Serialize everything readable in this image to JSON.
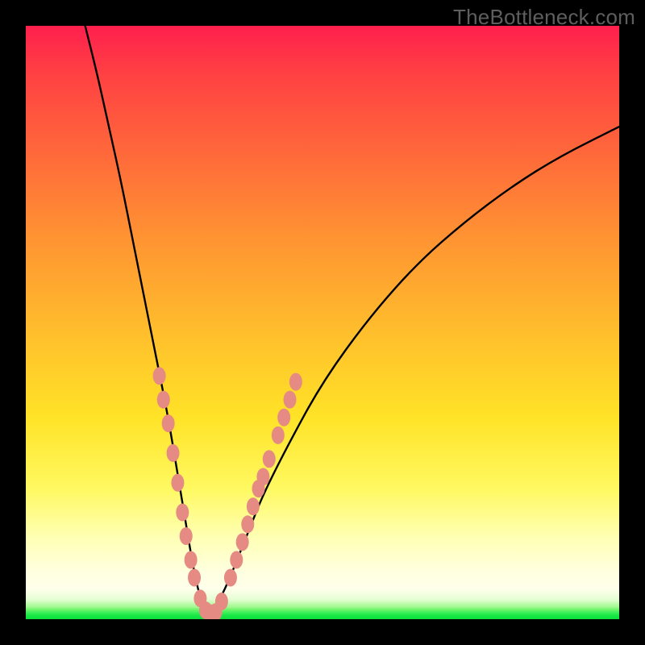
{
  "watermark": "TheBottleneck.com",
  "colors": {
    "background_outer": "#000000",
    "gradient_top": "#ff1f4e",
    "gradient_mid": "#ffe327",
    "gradient_low": "#ffffe0",
    "green_strip": "#15e845",
    "curve_stroke": "#000000",
    "dot_fill": "#e68a84"
  },
  "chart_data": {
    "type": "line",
    "title": "",
    "xlabel": "",
    "ylabel": "",
    "x_range": [
      0,
      100
    ],
    "y_range": [
      0,
      100
    ],
    "description": "V-shaped bottleneck curve: steep descending left branch, minimum near x≈30, rising right branch with decreasing slope. Curve overlaid on vertical red→yellow→green heat gradient. Salmon dots highlight the lower portion of both branches near the trough.",
    "series": [
      {
        "name": "bottleneck-curve-left",
        "x": [
          10,
          12,
          14,
          16,
          18,
          20,
          22,
          24,
          26,
          27,
          28,
          29,
          30,
          31
        ],
        "y": [
          100,
          92,
          83,
          74,
          64,
          54,
          44,
          34,
          22,
          16,
          10,
          5,
          2,
          0.5
        ]
      },
      {
        "name": "bottleneck-curve-right",
        "x": [
          31,
          32,
          34,
          36,
          38,
          40,
          44,
          50,
          58,
          66,
          74,
          82,
          90,
          100
        ],
        "y": [
          0.5,
          2,
          6,
          11,
          16,
          21,
          29,
          40,
          51,
          60,
          67,
          73,
          78,
          83
        ]
      }
    ],
    "highlight_dots": {
      "name": "near-minimum-dots",
      "points": [
        {
          "x": 22.5,
          "y": 41
        },
        {
          "x": 23.2,
          "y": 37
        },
        {
          "x": 24.0,
          "y": 33
        },
        {
          "x": 24.8,
          "y": 28
        },
        {
          "x": 25.6,
          "y": 23
        },
        {
          "x": 26.4,
          "y": 18
        },
        {
          "x": 27.0,
          "y": 14
        },
        {
          "x": 27.8,
          "y": 10
        },
        {
          "x": 28.4,
          "y": 7
        },
        {
          "x": 29.4,
          "y": 3.5
        },
        {
          "x": 30.3,
          "y": 1.5
        },
        {
          "x": 31.2,
          "y": 1
        },
        {
          "x": 32.0,
          "y": 1.2
        },
        {
          "x": 33.0,
          "y": 3
        },
        {
          "x": 34.5,
          "y": 7
        },
        {
          "x": 35.5,
          "y": 10
        },
        {
          "x": 36.5,
          "y": 13
        },
        {
          "x": 37.4,
          "y": 16
        },
        {
          "x": 38.3,
          "y": 19
        },
        {
          "x": 39.2,
          "y": 22
        },
        {
          "x": 40.0,
          "y": 24
        },
        {
          "x": 41.0,
          "y": 27
        },
        {
          "x": 42.5,
          "y": 31
        },
        {
          "x": 43.5,
          "y": 34
        },
        {
          "x": 44.5,
          "y": 37
        },
        {
          "x": 45.5,
          "y": 40
        }
      ]
    }
  }
}
